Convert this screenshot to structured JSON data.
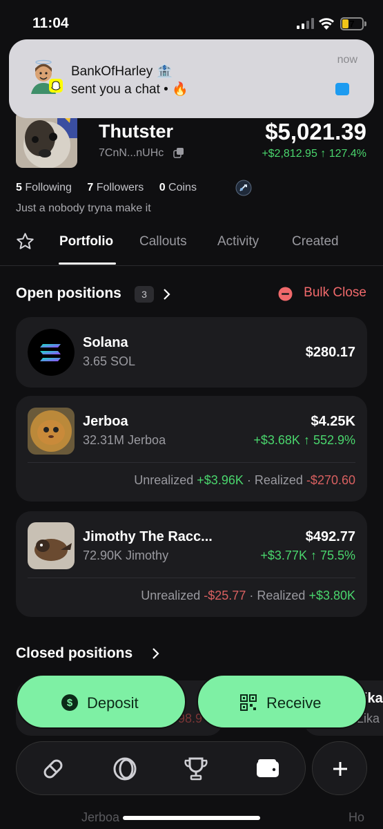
{
  "status": {
    "time": "11:04",
    "battery": "7"
  },
  "notification": {
    "title": "BankOfHarley 🏦",
    "body": "sent you a chat • 🔥",
    "time": "now"
  },
  "profile": {
    "name": "Thutster",
    "address": "7CnN...nUHc",
    "total_value": "$5,021.39",
    "total_change": "+$2,812.95 ↑ 127.4%",
    "following_count": "5",
    "following_label": "Following",
    "followers_count": "7",
    "followers_label": "Followers",
    "coins_count": "0",
    "coins_label": "Coins",
    "bio": "Just a nobody tryna make it"
  },
  "tabs": [
    {
      "label": "Portfolio"
    },
    {
      "label": "Callouts"
    },
    {
      "label": "Activity"
    },
    {
      "label": "Created"
    }
  ],
  "open_positions": {
    "title": "Open positions",
    "count": "3",
    "bulk_close": "Bulk Close",
    "items": [
      {
        "name": "Solana",
        "amount": "3.65 SOL",
        "value": "$280.17"
      },
      {
        "name": "Jerboa",
        "amount": "32.31M Jerboa",
        "value": "$4.25K",
        "change": "+$3.68K ↑ 552.9%",
        "unrealized_label": "Unrealized",
        "unrealized": "+$3.96K",
        "sep": "·",
        "realized_label": "Realized",
        "realized": "-$270.60"
      },
      {
        "name": "Jimothy The Racc...",
        "amount": "72.90K Jimothy",
        "value": "$492.77",
        "change": "+$3.77K ↑ 75.5%",
        "unrealized_label": "Unrealized",
        "unrealized": "-$25.77",
        "sep": "·",
        "realized_label": "Realized",
        "realized": "+$3.80K"
      }
    ]
  },
  "closed_positions": {
    "title": "Closed positions",
    "partial_value": "98.9",
    "partial_name_a": "ika",
    "partial_name_b": "Lika",
    "partial_jerboa": "Jerboa",
    "partial_ho": "Ho"
  },
  "actions": {
    "deposit": "Deposit",
    "receive": "Receive"
  },
  "colors": {
    "positive": "#4ad66d",
    "negative": "#d86060",
    "accent": "#7ef0a4"
  }
}
